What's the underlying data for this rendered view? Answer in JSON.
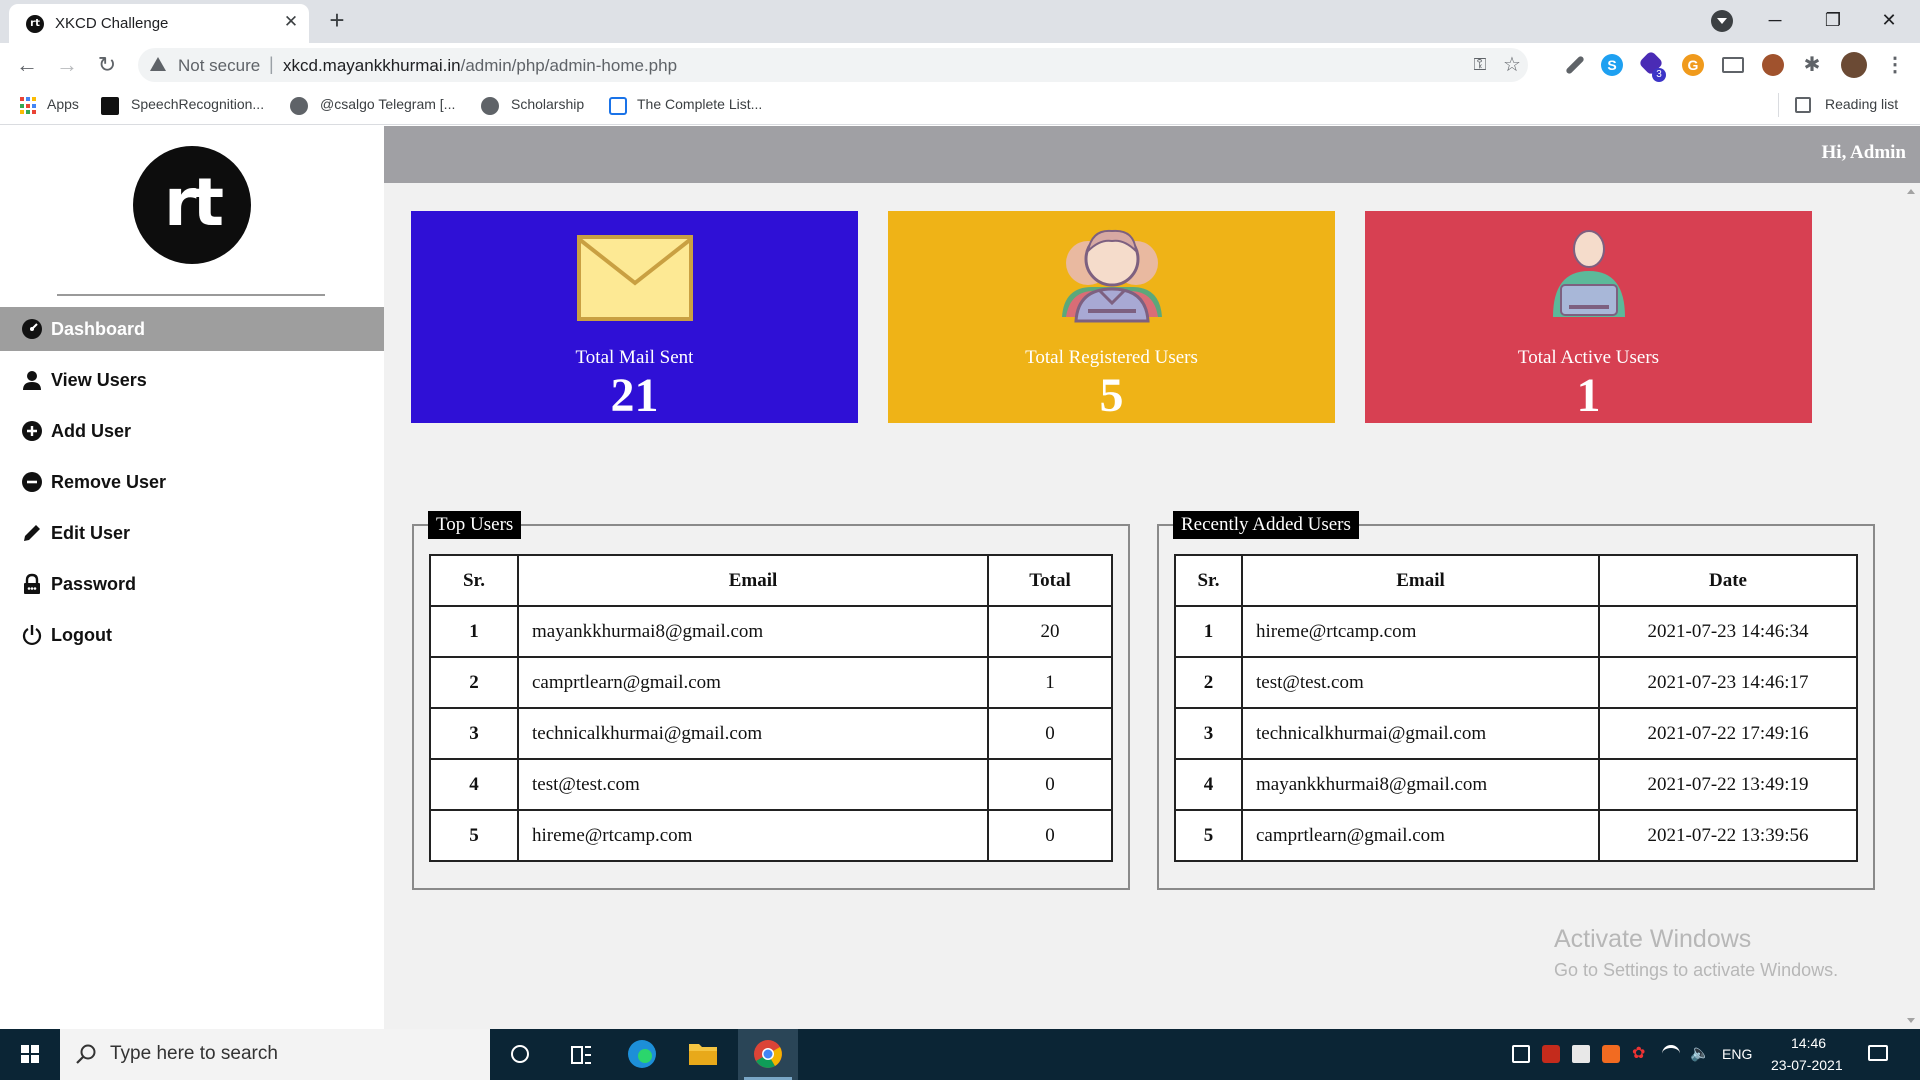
{
  "browser": {
    "tab_title": "XKCD Challenge",
    "tab_close": "✕",
    "new_tab": "+",
    "security": "Not secure",
    "url_host": "xkcd.mayankkhurmai.in",
    "url_path": "/admin/php/admin-home.php",
    "bookmarks": [
      "Apps",
      "SpeechRecognition...",
      "@csalgo Telegram [...",
      "Scholarship",
      "The Complete List..."
    ],
    "reading_list": "Reading list",
    "extension_badge": "3"
  },
  "sidebar": {
    "logo_text": "rt",
    "items": [
      {
        "label": "Dashboard",
        "icon": "dashboard-icon"
      },
      {
        "label": "View Users",
        "icon": "user-icon"
      },
      {
        "label": "Add User",
        "icon": "plus-circle-icon"
      },
      {
        "label": "Remove User",
        "icon": "minus-circle-icon"
      },
      {
        "label": "Edit User",
        "icon": "pencil-icon"
      },
      {
        "label": "Password",
        "icon": "lock-icon"
      },
      {
        "label": "Logout",
        "icon": "power-icon"
      }
    ]
  },
  "header": {
    "greeting": "Hi, Admin"
  },
  "cards": [
    {
      "label": "Total Mail Sent",
      "value": "21",
      "color": "#2f10d6",
      "icon": "envelope-icon"
    },
    {
      "label": "Total Registered Users",
      "value": "5",
      "color": "#efb317",
      "icon": "users-group-icon"
    },
    {
      "label": "Total Active Users",
      "value": "1",
      "color": "#d74052",
      "icon": "active-user-icon"
    }
  ],
  "top_users": {
    "legend": "Top Users",
    "headers": [
      "Sr.",
      "Email",
      "Total"
    ],
    "rows": [
      [
        "1",
        "mayankkhurmai8@gmail.com",
        "20"
      ],
      [
        "2",
        "camprtlearn@gmail.com",
        "1"
      ],
      [
        "3",
        "technicalkhurmai@gmail.com",
        "0"
      ],
      [
        "4",
        "test@test.com",
        "0"
      ],
      [
        "5",
        "hireme@rtcamp.com",
        "0"
      ]
    ]
  },
  "recent_users": {
    "legend": "Recently Added Users",
    "headers": [
      "Sr.",
      "Email",
      "Date"
    ],
    "rows": [
      [
        "1",
        "hireme@rtcamp.com",
        "2021-07-23 14:46:34"
      ],
      [
        "2",
        "test@test.com",
        "2021-07-23 14:46:17"
      ],
      [
        "3",
        "technicalkhurmai@gmail.com",
        "2021-07-22 17:49:16"
      ],
      [
        "4",
        "mayankkhurmai8@gmail.com",
        "2021-07-22 13:49:19"
      ],
      [
        "5",
        "camprtlearn@gmail.com",
        "2021-07-22 13:39:56"
      ]
    ]
  },
  "watermark": {
    "title": "Activate Windows",
    "subtitle": "Go to Settings to activate Windows."
  },
  "taskbar": {
    "search_placeholder": "Type here to search",
    "language": "ENG",
    "time": "14:46",
    "date": "23-07-2021"
  }
}
